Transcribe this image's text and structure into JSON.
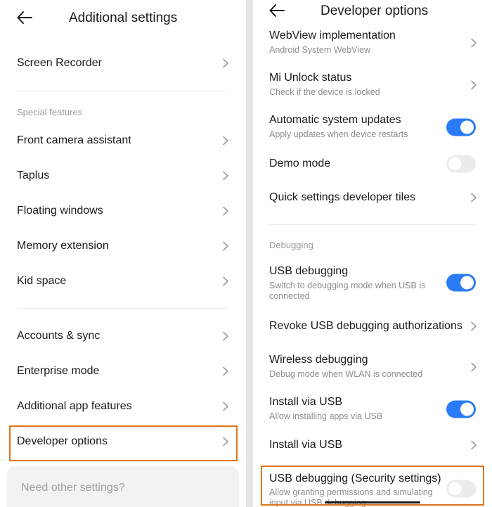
{
  "left": {
    "title": "Additional settings",
    "items": [
      {
        "label": "Screen Recorder"
      },
      {
        "label": "Front camera assistant"
      },
      {
        "label": "Taplus"
      },
      {
        "label": "Floating windows"
      },
      {
        "label": "Memory extension"
      },
      {
        "label": "Kid space"
      },
      {
        "label": "Accounts & sync"
      },
      {
        "label": "Enterprise mode"
      },
      {
        "label": "Additional app features"
      },
      {
        "label": "Developer options"
      }
    ],
    "section_special": "Special features",
    "search_placeholder": "Need other settings?"
  },
  "right": {
    "title": "Developer options",
    "section_debugging": "Debugging",
    "items": [
      {
        "label": "WebView implementation",
        "sub": "Android System WebView",
        "control": "chevron"
      },
      {
        "label": "Mi Unlock status",
        "sub": "Check if the device is locked",
        "control": "chevron"
      },
      {
        "label": "Automatic system updates",
        "sub": "Apply updates when device restarts",
        "control": "toggle",
        "on": true
      },
      {
        "label": "Demo mode",
        "control": "toggle",
        "on": false
      },
      {
        "label": "Quick settings developer tiles",
        "control": "chevron"
      },
      {
        "label": "USB debugging",
        "sub": "Switch to debugging mode when USB is connected",
        "control": "toggle",
        "on": true
      },
      {
        "label": "Revoke USB debugging authorizations",
        "control": "chevron"
      },
      {
        "label": "Wireless debugging",
        "sub": "Debug mode when WLAN is connected",
        "control": "chevron"
      },
      {
        "label": "Install via USB",
        "sub": "Allow installing apps via USB",
        "control": "toggle",
        "on": true
      },
      {
        "label": "Install via USB",
        "control": "chevron"
      },
      {
        "label": "USB debugging (Security settings)",
        "sub": "Allow granting permissions and simulating input via USB debugging",
        "control": "toggle",
        "on": false
      }
    ]
  },
  "colors": {
    "accent_blue": "#2a7cf6",
    "highlight_orange": "#e07418",
    "toggle_off": "#ececec",
    "subtitle_gray": "#8d8d8d"
  },
  "icons": {
    "back": "back-arrow-icon",
    "chevron": "chevron-right-icon"
  }
}
